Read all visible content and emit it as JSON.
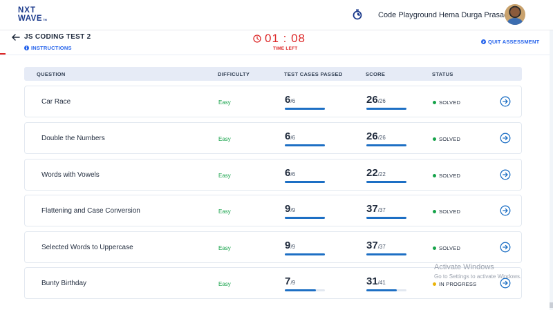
{
  "header": {
    "logo_line1": "NXT",
    "logo_line2": "WAVE",
    "logo_tm": "TM",
    "nav_link": "Code Playground",
    "user_name": "Hema Durga Prasad"
  },
  "subheader": {
    "test_title": "JS CODING TEST 2",
    "instructions_label": "INSTRUCTIONS",
    "timer": "01 : 08",
    "timer_label": "TIME LEFT",
    "quit_label": "QUIT ASSESSMENT"
  },
  "table": {
    "columns": [
      "QUESTION",
      "DIFFICULTY",
      "TEST CASES PASSED",
      "SCORE",
      "STATUS"
    ],
    "rows": [
      {
        "question": "Car Race",
        "difficulty": "Easy",
        "passed": "6",
        "total": "/6",
        "passed_fraction": 1.0,
        "score": "26",
        "score_total": "/26",
        "score_fraction": 1.0,
        "status": "SOLVED",
        "status_color": "#16a34a"
      },
      {
        "question": "Double the Numbers",
        "difficulty": "Easy",
        "passed": "6",
        "total": "/6",
        "passed_fraction": 1.0,
        "score": "26",
        "score_total": "/26",
        "score_fraction": 1.0,
        "status": "SOLVED",
        "status_color": "#16a34a"
      },
      {
        "question": "Words with Vowels",
        "difficulty": "Easy",
        "passed": "6",
        "total": "/6",
        "passed_fraction": 1.0,
        "score": "22",
        "score_total": "/22",
        "score_fraction": 1.0,
        "status": "SOLVED",
        "status_color": "#16a34a"
      },
      {
        "question": "Flattening and Case Conversion",
        "difficulty": "Easy",
        "passed": "9",
        "total": "/9",
        "passed_fraction": 1.0,
        "score": "37",
        "score_total": "/37",
        "score_fraction": 1.0,
        "status": "SOLVED",
        "status_color": "#16a34a"
      },
      {
        "question": "Selected Words to Uppercase",
        "difficulty": "Easy",
        "passed": "9",
        "total": "/9",
        "passed_fraction": 1.0,
        "score": "37",
        "score_total": "/37",
        "score_fraction": 1.0,
        "status": "SOLVED",
        "status_color": "#16a34a"
      },
      {
        "question": "Bunty Birthday",
        "difficulty": "Easy",
        "passed": "7",
        "total": "/9",
        "passed_fraction": 0.778,
        "score": "31",
        "score_total": "/41",
        "score_fraction": 0.756,
        "status": "IN PROGRESS",
        "status_color": "#eab308"
      }
    ]
  },
  "watermark": {
    "title": "Activate Windows",
    "subtitle": "Go to Settings to activate Windows."
  },
  "colors": {
    "brand": "#1b3a8c",
    "accent": "#2563eb",
    "timer": "#dc2626",
    "progress": "#1d6fc4",
    "easy": "#16a34a"
  },
  "icons": {
    "back": "arrow-left-icon",
    "timer": "stopwatch-icon",
    "clock": "clock-icon",
    "info": "info-icon",
    "quit": "quit-icon",
    "go": "arrow-right-circle-icon"
  }
}
